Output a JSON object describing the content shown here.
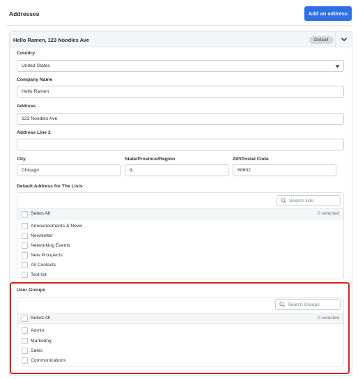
{
  "header": {
    "title": "Addresses",
    "add_button": "Add an address"
  },
  "address": {
    "title": "Hello Ramen, 123 Noodles Ave",
    "badge": "Default",
    "country_label": "Country",
    "country_value": "United States",
    "company_label": "Company Name",
    "company_value": "Hello Ramen",
    "address_label": "Address",
    "address_value": "123 Noodles Ave",
    "address2_label": "Address Line 2",
    "address2_value": "",
    "city_label": "City",
    "city_value": "Chicago",
    "state_label": "State/Province/Region",
    "state_value": "IL",
    "zip_label": "ZIP/Postal Code",
    "zip_value": "60602"
  },
  "lists": {
    "label": "Default Address for The Lists",
    "search_placeholder": "Search lists",
    "select_all": "Select All",
    "selected_count": "0 selected",
    "items": [
      "Announcements & News",
      "Newsletter",
      "Networking Events",
      "New Prospects",
      "All Contacts",
      "Test list"
    ]
  },
  "groups": {
    "label": "User Groups",
    "search_placeholder": "Search Groups",
    "select_all": "Select All",
    "selected_count": "0 selected",
    "items": [
      "Admin",
      "Marketing",
      "Sales",
      "Communications"
    ]
  },
  "colors": {
    "accent": "#2f6fe6",
    "highlight": "#d9211e"
  },
  "icons": {
    "search": "search-icon",
    "collapse": "chevron-down-icon",
    "select": "caret-down-icon"
  }
}
